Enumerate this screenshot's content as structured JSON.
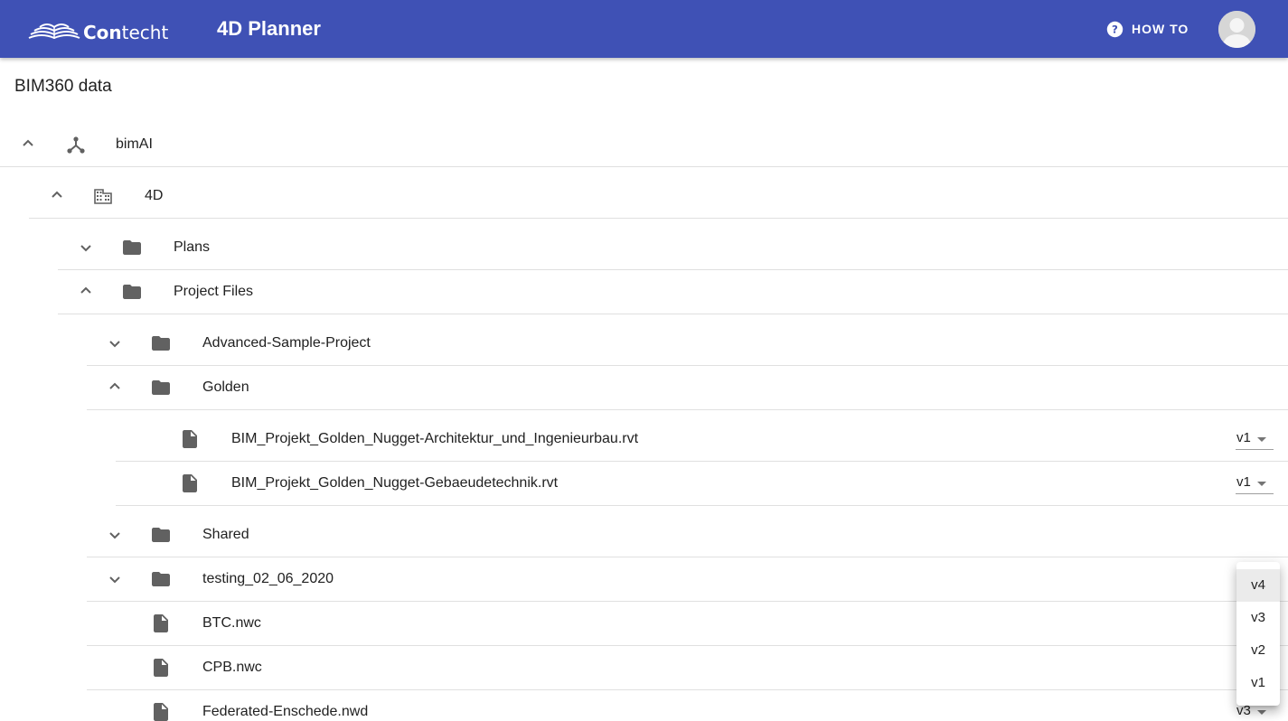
{
  "header": {
    "logo_text_bold": "Con",
    "logo_text_rest": "techt",
    "logo_icon": "contecht-book-logo",
    "title": "4D Planner",
    "howto_label": "HOW TO",
    "howto_icon": "help-circle-icon",
    "avatar_icon": "person-avatar-icon",
    "color": "#3f51b5"
  },
  "section_title": "BIM360 data",
  "tree": {
    "hub": {
      "label": "bimAI",
      "icon": "hub-icon",
      "expanded": true
    },
    "project": {
      "label": "4D",
      "icon": "building-icon",
      "expanded": true
    },
    "plans": {
      "label": "Plans",
      "icon": "folder-icon",
      "expanded": false
    },
    "project_files": {
      "label": "Project Files",
      "icon": "folder-icon",
      "expanded": true
    },
    "advanced": {
      "label": "Advanced-Sample-Project",
      "icon": "folder-icon",
      "expanded": false
    },
    "golden": {
      "label": "Golden",
      "icon": "folder-icon",
      "expanded": true
    },
    "golden_file_1": {
      "label": "BIM_Projekt_Golden_Nugget-Architektur_und_Ingenieurbau.rvt",
      "icon": "file-icon",
      "version": "v1"
    },
    "golden_file_2": {
      "label": "BIM_Projekt_Golden_Nugget-Gebaeudetechnik.rvt",
      "icon": "file-icon",
      "version": "v1"
    },
    "shared": {
      "label": "Shared",
      "icon": "folder-icon",
      "expanded": false
    },
    "testing": {
      "label": "testing_02_06_2020",
      "icon": "folder-icon",
      "expanded": false
    },
    "btc": {
      "label": "BTC.nwc",
      "icon": "file-icon"
    },
    "cpb": {
      "label": "CPB.nwc",
      "icon": "file-icon"
    },
    "federated": {
      "label": "Federated-Enschede.nwd",
      "icon": "file-icon",
      "version": "v3"
    }
  },
  "version_menu": {
    "options": [
      "v4",
      "v3",
      "v2",
      "v1"
    ],
    "highlighted": "v4"
  }
}
